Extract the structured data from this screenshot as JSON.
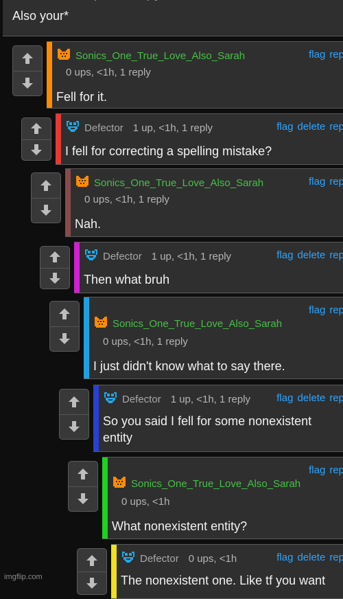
{
  "comments": [
    {
      "user": "Defector",
      "meta": "1 up, <1h, 1 reply",
      "actions": [
        "flag",
        "delete",
        "rep"
      ],
      "text": "Also your*",
      "color": "#3a86ff"
    },
    {
      "user": "Sonics_One_True_Love_Also_Sarah",
      "meta": "0 ups, <1h, 1 reply",
      "actions": [
        "flag",
        "rep"
      ],
      "text": "Fell for it.",
      "color": "#ff8c00"
    },
    {
      "user": "Defector",
      "meta": "1 up, <1h, 1 reply",
      "actions": [
        "flag",
        "delete",
        "rep"
      ],
      "text": "I fell for correcting a spelling mistake?",
      "color": "#e53935"
    },
    {
      "user": "Sonics_One_True_Love_Also_Sarah",
      "meta": "0 ups, <1h, 1 reply",
      "actions": [
        "flag",
        "rep"
      ],
      "text": "Nah.",
      "color": "#8b4a4a"
    },
    {
      "user": "Defector",
      "meta": "1 up, <1h, 1 reply",
      "actions": [
        "flag",
        "delete",
        "rep"
      ],
      "text": "Then what bruh",
      "color": "#d21fd2"
    },
    {
      "user": "Sonics_One_True_Love_Also_Sarah",
      "meta": "0 ups, <1h, 1 reply",
      "actions": [
        "flag",
        "rep"
      ],
      "text": "I just didn't know what to say there.",
      "color": "#1ea0e0"
    },
    {
      "user": "Defector",
      "meta": "1 up, <1h, 1 reply",
      "actions": [
        "flag",
        "delete",
        "rep"
      ],
      "text": "So you said I fell for some nonexistent entity",
      "color": "#2a3fd4"
    },
    {
      "user": "Sonics_One_True_Love_Also_Sarah",
      "meta": "0 ups, <1h",
      "actions": [
        "flag",
        "rep"
      ],
      "text": "What nonexistent entity?",
      "color": "#1ed21e"
    },
    {
      "user": "Defector",
      "meta": "0 ups, <1h",
      "actions": [
        "flag",
        "delete",
        "rep"
      ],
      "text": "The nonexistent one. Like tf you want",
      "color": "#f0e01e"
    }
  ],
  "icons": {
    "upvote": "arrow-up-icon",
    "downvote": "arrow-down-icon",
    "avatar_defector": "pixel-face-blue-icon",
    "avatar_sarah": "pixel-face-orange-icon"
  },
  "colors": {
    "link": "#2ea4ff",
    "sarah_name": "#46c046",
    "defector_avatar": "#1ea8e8",
    "sarah_avatar": "#ff8c00"
  },
  "watermark": "imgflip.com"
}
